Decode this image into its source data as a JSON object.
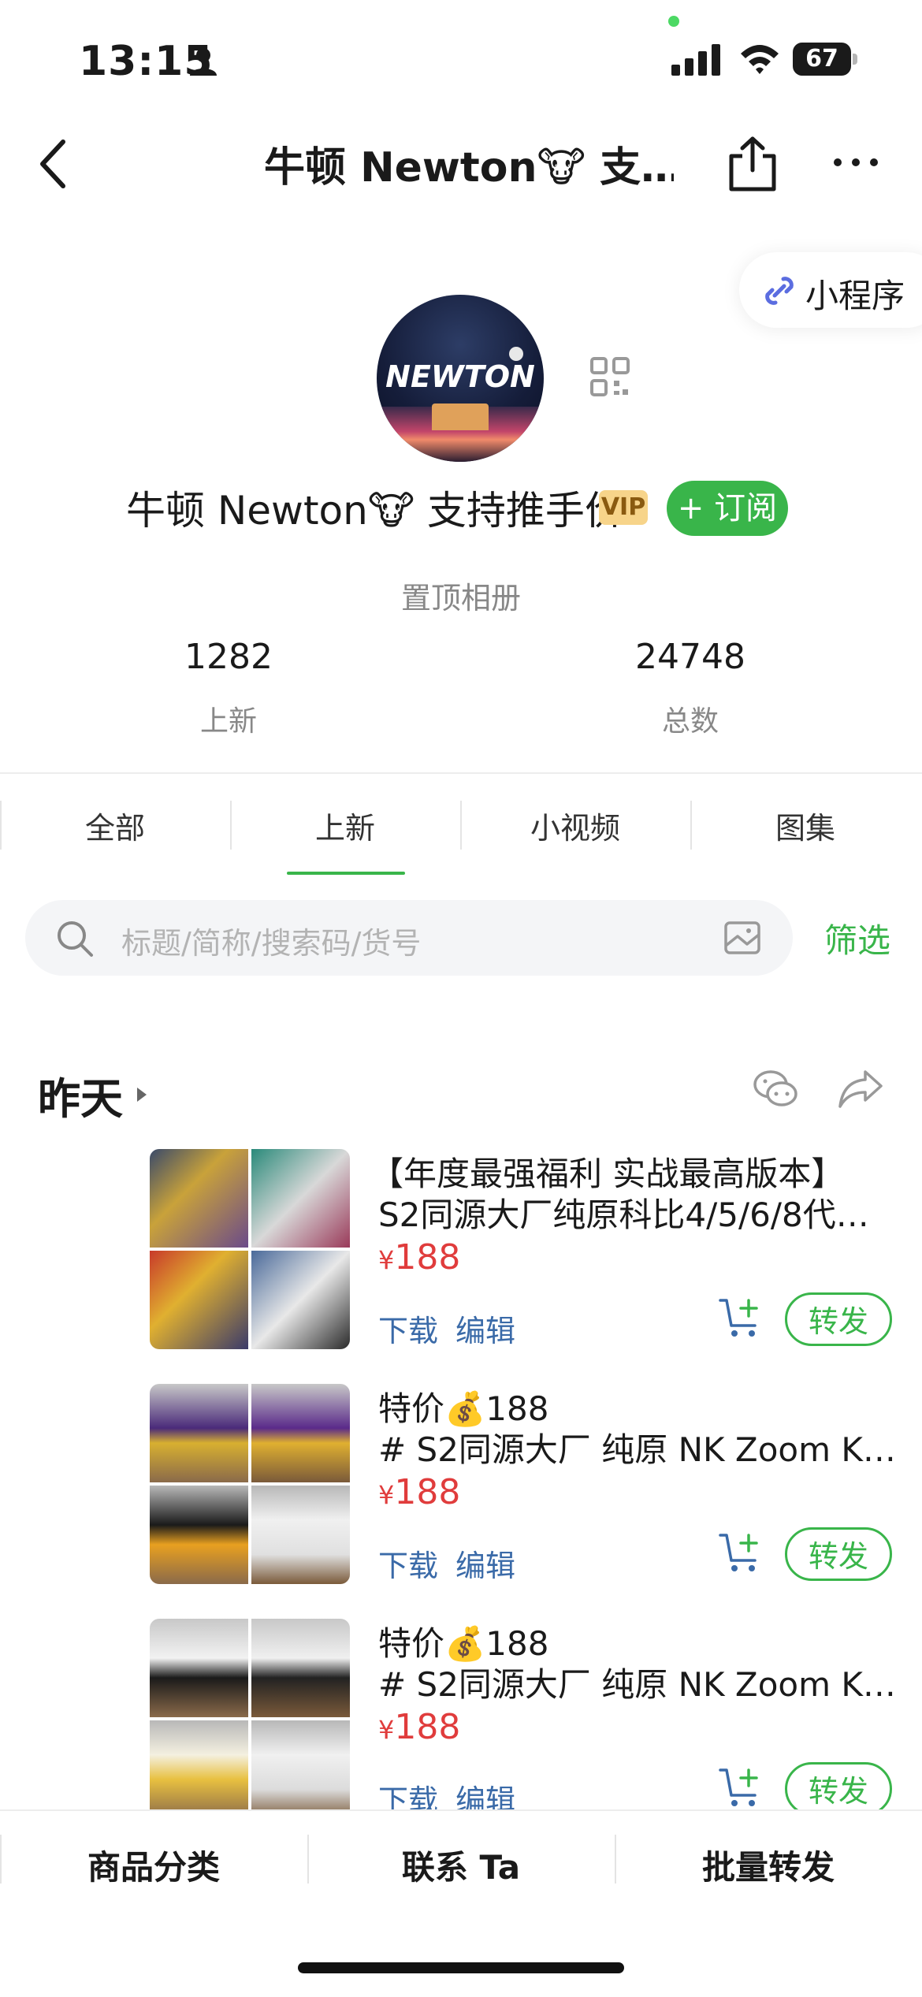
{
  "status_bar": {
    "time": "13:15",
    "battery": "67"
  },
  "nav": {
    "title": "牛顿 Newton🐮 支…"
  },
  "mini_program": {
    "label": "小程序"
  },
  "profile": {
    "avatar_text": "NEWTON",
    "name": "牛顿 Newton🐮 支持推手价",
    "vip": "VIP",
    "subscribe": "+ 订阅",
    "pinned_album": "置顶相册",
    "stats": [
      {
        "value": "1282",
        "label": "上新"
      },
      {
        "value": "24748",
        "label": "总数"
      }
    ]
  },
  "tabs": [
    {
      "label": "全部"
    },
    {
      "label": "上新"
    },
    {
      "label": "小视频"
    },
    {
      "label": "图集"
    }
  ],
  "search": {
    "placeholder": "标题/简称/搜索码/货号",
    "filter": "筛选"
  },
  "section": {
    "title": "昨天"
  },
  "products": [
    {
      "title1": "【年度最强福利 实战最高版本】",
      "title2": "S2同源大厂纯原科比4/5/6/8代…",
      "yen": "¥",
      "price": "188",
      "download": "下载",
      "edit": "编辑",
      "forward": "转发"
    },
    {
      "title1": "特价💰188",
      "title2": "# S2同源大厂 纯原 NK Zoom K…",
      "yen": "¥",
      "price": "188",
      "download": "下载",
      "edit": "编辑",
      "forward": "转发"
    },
    {
      "title1": "特价💰188",
      "title2": "# S2同源大厂 纯原 NK Zoom K…",
      "yen": "¥",
      "price": "188",
      "download": "下载",
      "edit": "编辑",
      "forward": "转发"
    }
  ],
  "bottom_bar": [
    {
      "label": "商品分类"
    },
    {
      "label": "联系 Ta"
    },
    {
      "label": "批量转发"
    }
  ],
  "colors": {
    "accent": "#39b54a",
    "price": "#e03c3c",
    "link": "#3a6aa8"
  }
}
